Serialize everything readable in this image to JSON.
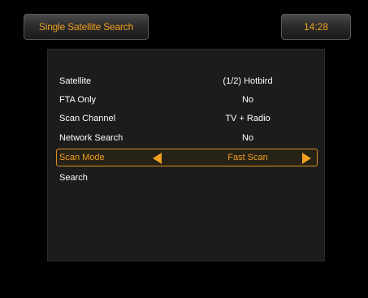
{
  "header": {
    "title": "Single Satellite Search",
    "clock": "14:28"
  },
  "menu": {
    "rows": [
      {
        "label": "Satellite",
        "value": "(1/2) Hotbird"
      },
      {
        "label": "FTA Only",
        "value": "No"
      },
      {
        "label": "Scan Channel",
        "value": "TV + Radio"
      },
      {
        "label": "Network Search",
        "value": "No"
      },
      {
        "label": "Scan Mode",
        "value": "Fast Scan",
        "selected": true
      },
      {
        "label": "Search",
        "value": ""
      }
    ]
  },
  "colors": {
    "accent": "#f0a020",
    "panel": "#1c1c1c",
    "background": "#000000",
    "text": "#ffffff"
  },
  "icons": {
    "left": "left-arrow-icon",
    "right": "right-arrow-icon"
  }
}
